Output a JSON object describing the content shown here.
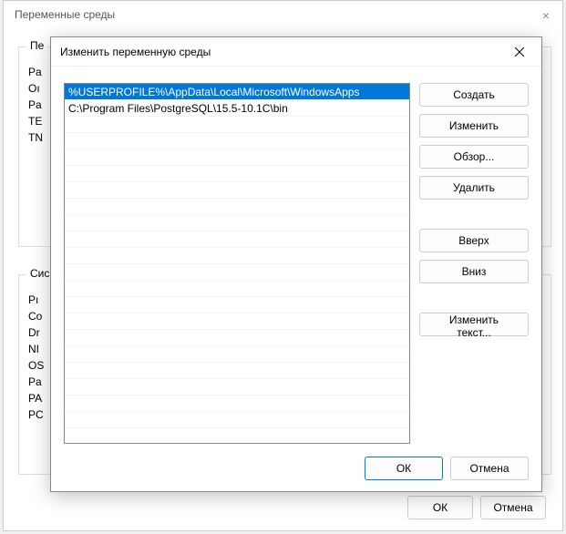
{
  "bg": {
    "title": "Переменные среды",
    "group_user_label": "Пе",
    "group_sys_label": "Сис",
    "user_items": [
      "Pa",
      "Oı",
      "Pa",
      "TE",
      "TN"
    ],
    "sys_items": [
      "Pı",
      "Co",
      "Dr",
      "NI",
      "OS",
      "Pa",
      "PA",
      "PC"
    ],
    "ok": "ОК",
    "cancel": "Отмена"
  },
  "modal": {
    "title": "Изменить переменную среды",
    "paths": [
      "%USERPROFILE%\\AppData\\Local\\Microsoft\\WindowsApps",
      "C:\\Program Files\\PostgreSQL\\15.5-10.1C\\bin"
    ],
    "empty_rows": 20,
    "buttons": {
      "new": "Создать",
      "edit": "Изменить",
      "browse": "Обзор...",
      "delete": "Удалить",
      "up": "Вверх",
      "down": "Вниз",
      "edit_text": "Изменить текст..."
    },
    "ok": "ОК",
    "cancel": "Отмена"
  }
}
